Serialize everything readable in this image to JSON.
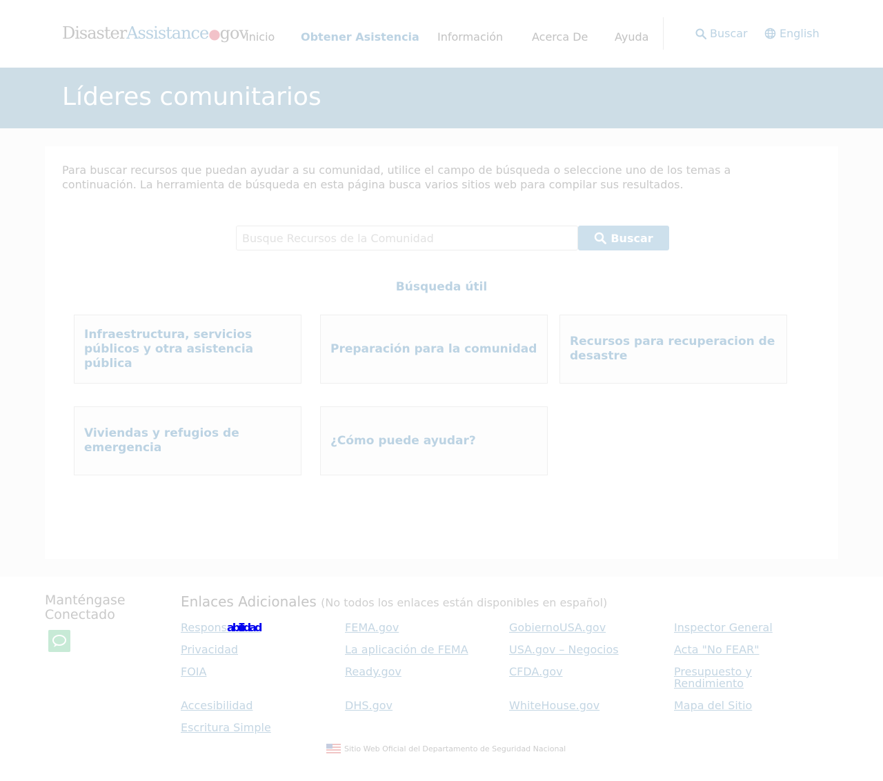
{
  "header": {
    "logo": {
      "part1": "Disaster",
      "part2": "Assistance",
      "dot": "●",
      "part3": "gov"
    },
    "nav": [
      {
        "label": "Inicio",
        "active": false
      },
      {
        "label": "Obtener Asistencia",
        "active": true
      },
      {
        "label": "Información",
        "active": false
      },
      {
        "label": "Acerca De",
        "active": false
      },
      {
        "label": "Ayuda",
        "active": false
      }
    ],
    "search_label": "Buscar",
    "language_label": "English"
  },
  "banner": {
    "title": "Líderes comunitarios"
  },
  "main": {
    "intro": "Para buscar recursos que puedan ayudar a su comunidad, utilice el campo de búsqueda o seleccione uno de los temas a continuación. La herramienta de búsqueda en esta página busca varios sitios web para compilar sus resultados.",
    "search": {
      "placeholder": "Busque Recursos de la Comunidad",
      "value": "",
      "button_label": "Buscar"
    },
    "helpful_title": "Búsqueda útil",
    "topics": [
      "Infraestructura, servicios públicos y otra asistencia pública",
      "Preparación para la comunidad",
      "Recursos para recuperacion de desastre",
      "Viviendas y refugios de emergencia",
      "¿Cómo puede ayudar?"
    ]
  },
  "footer": {
    "stay_connected": "Manténgase Conectado",
    "links_title": "Enlaces Adicionales",
    "links_note": "(No todos los enlaces están disponibles en español)",
    "links": {
      "responsabilidad_start": "Respons",
      "responsabilidad_glitch": "abilidad",
      "fema": "FEMA.gov",
      "gobierno": "GobiernoUSA.gov",
      "inspector": "Inspector General",
      "privacidad": "Privacidad",
      "app_fema": "La aplicación de FEMA",
      "usa_negocios": "USA.gov – Negocios",
      "no_fear": "Acta \"No FEAR\"",
      "foia": "FOIA",
      "ready": "Ready.gov",
      "cfda": "CFDA.gov",
      "presupuesto": "Presupuesto y Rendimiento",
      "accesibilidad": "Accesibilidad",
      "dhs": "DHS.gov",
      "whitehouse": "WhiteHouse.gov",
      "mapa": "Mapa del Sitio",
      "escritura": "Escritura Simple"
    },
    "official_text": "Sitio Web Oficial del Departamento de Seguridad Nacional"
  },
  "colors": {
    "accent": "#bcd3e3",
    "banner": "#cddde6",
    "button": "#cde0ec",
    "link": "#c4d6e3",
    "chat": "#c7ead6"
  },
  "icons": [
    "search-icon",
    "globe-icon",
    "chat-icon",
    "us-flag-icon"
  ]
}
